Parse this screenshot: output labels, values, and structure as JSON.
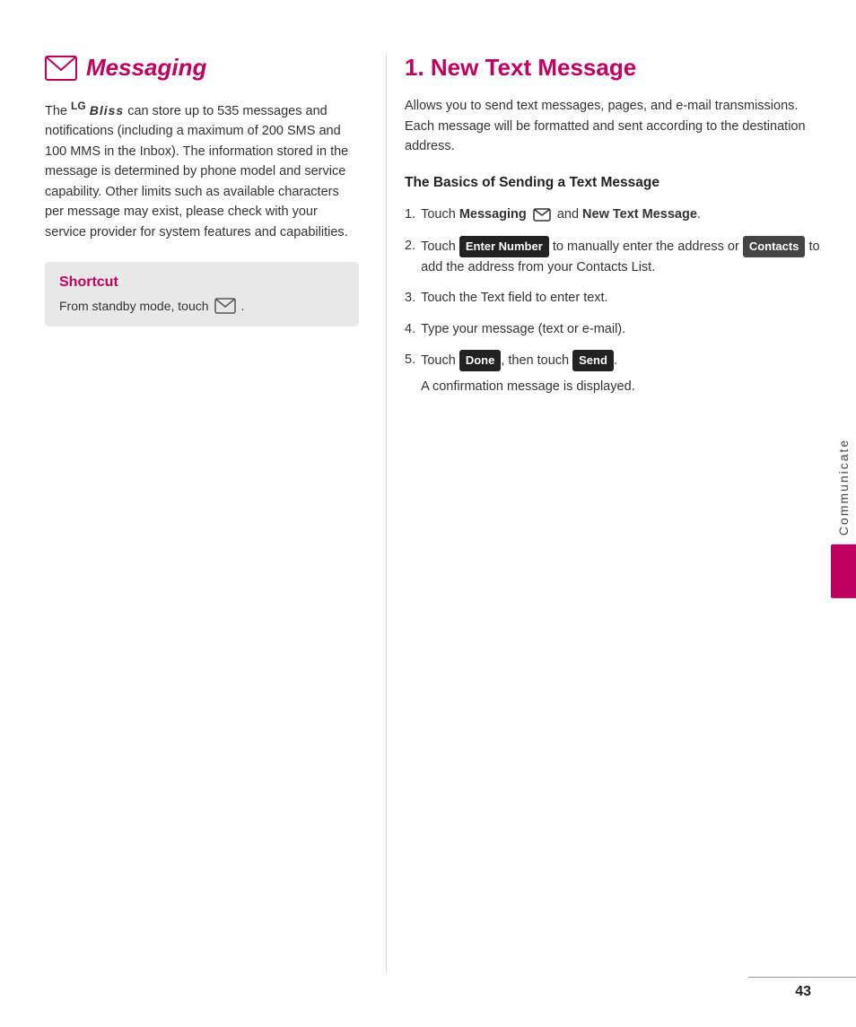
{
  "left": {
    "section_title": "Messaging",
    "icon_label": "messaging-section-icon",
    "body": "The LG Bliss can store up to 535 messages and notifications (including a maximum of 200 SMS and 100 MMS in the Inbox). The information stored in the message is determined by phone model and service capability. Other limits such as available characters per message may exist, please check with your service provider for system features and capabilities.",
    "shortcut": {
      "title": "Shortcut",
      "text": "From standby mode, touch"
    }
  },
  "right": {
    "section_title": "1. New Text Message",
    "intro": "Allows you to send text messages, pages, and e-mail transmissions. Each message will be formatted and sent according to the destination address.",
    "sub_heading": "The Basics of Sending a Text Message",
    "steps": [
      {
        "num": "1.",
        "text_before": "Touch",
        "bold1": "Messaging",
        "text_mid": "and",
        "bold2": "New Text Message",
        "text_after": ".",
        "type": "messaging"
      },
      {
        "num": "2.",
        "text_before": "Touch",
        "btn1": "Enter Number",
        "text_mid": "to manually enter the address or",
        "btn2": "Contacts",
        "text_after": "to add the address from your Contacts List.",
        "type": "enter"
      },
      {
        "num": "3.",
        "text": "Touch the Text field to enter text.",
        "type": "plain"
      },
      {
        "num": "4.",
        "text": "Type your message (text or e-mail).",
        "type": "plain"
      },
      {
        "num": "5.",
        "text_before": "Touch",
        "btn1": "Done",
        "text_mid": ", then touch",
        "btn2": "Send",
        "text_after": ".",
        "type": "done"
      }
    ],
    "confirmation": "A confirmation message is displayed."
  },
  "side_tab": {
    "label": "Communicate"
  },
  "page_number": "43"
}
